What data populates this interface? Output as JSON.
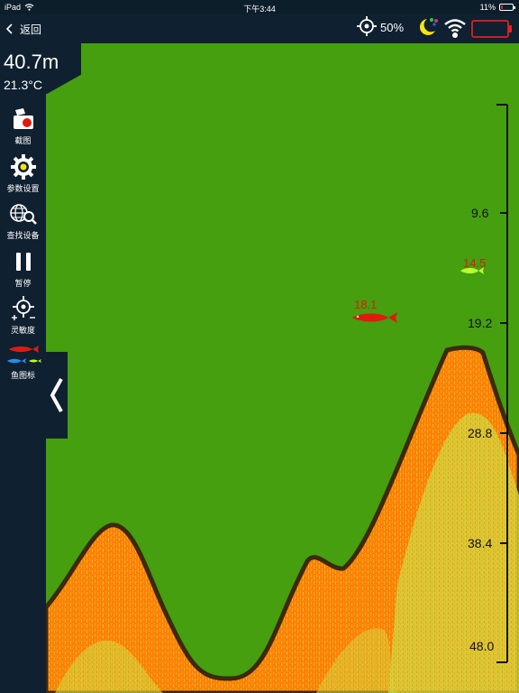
{
  "status_bar": {
    "device": "iPad",
    "time": "下午3:44",
    "battery_percent": "11%"
  },
  "header": {
    "back_label": "返回",
    "zoom_value": "50%"
  },
  "readouts": {
    "depth": "40.7m",
    "temperature": "21.3°C"
  },
  "sidebar": {
    "items": [
      {
        "label": "截图",
        "icon": "screenshot-camera-icon"
      },
      {
        "label": "参数设置",
        "icon": "gear-icon"
      },
      {
        "label": "查找设备",
        "icon": "globe-search-icon"
      },
      {
        "label": "暂停",
        "icon": "pause-icon"
      },
      {
        "label": "灵敏度",
        "icon": "sensitivity-crosshair-icon"
      },
      {
        "label": "鱼图标",
        "icon": "fish-icons-icon"
      }
    ]
  },
  "depth_scale": [
    "9.6",
    "19.2",
    "28.8",
    "38.4",
    "48.0"
  ],
  "fish": [
    {
      "depth_label": "18.1",
      "color": "#e01a10"
    },
    {
      "depth_label": "14.5",
      "color": "#b7ff2a"
    }
  ],
  "colors": {
    "background_water": "#459f0f",
    "bottom_fill": "#ff7f05",
    "bottom_texture": "#c9d436",
    "bottom_edge": "#3c2a10",
    "panel": "#0f2030",
    "battery_low": "#e02020"
  }
}
